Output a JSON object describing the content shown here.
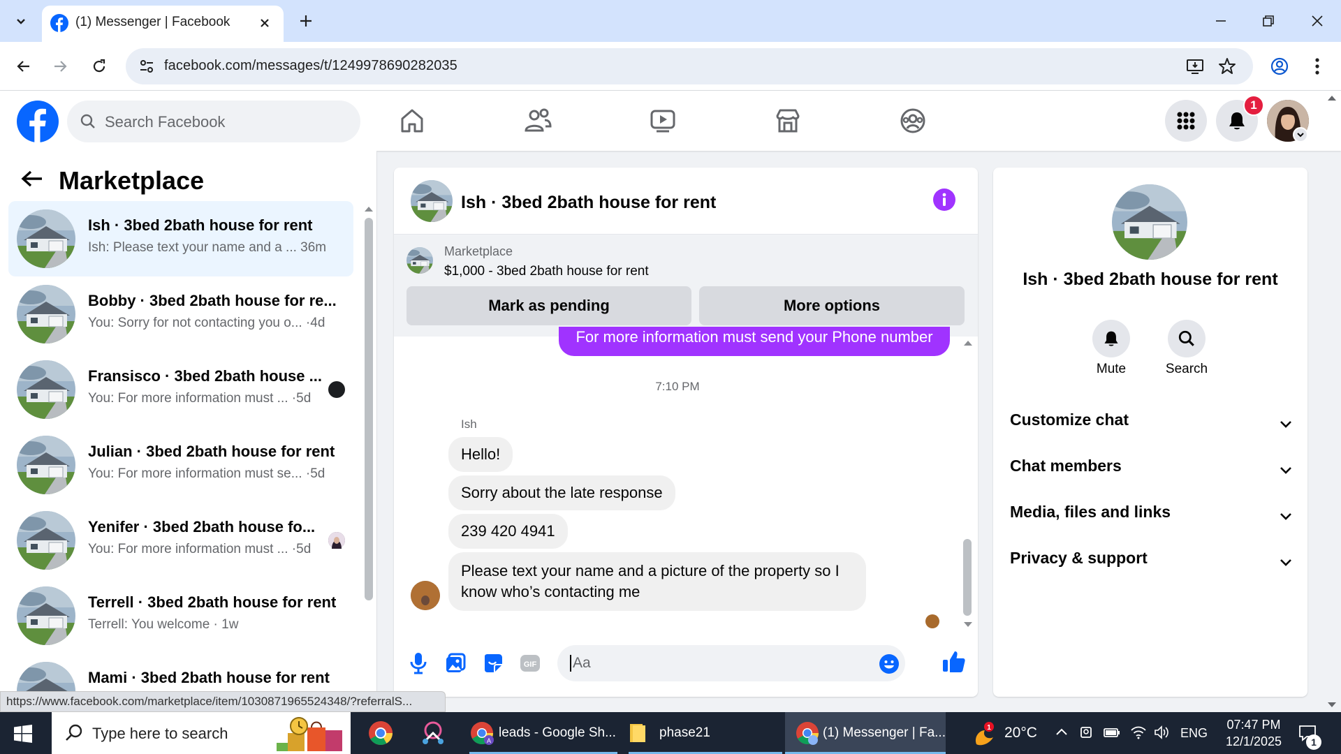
{
  "browser": {
    "tab_title": "(1) Messenger | Facebook",
    "url": "facebook.com/messages/t/1249978690282035",
    "status_url": "https://www.facebook.com/marketplace/item/1030871965524348/?referralS..."
  },
  "fb_nav": {
    "search_placeholder": "Search Facebook",
    "notification_count": "1"
  },
  "left_panel": {
    "heading": "Marketplace",
    "conversations": [
      {
        "name": "Ish · 3bed 2bath house for rent",
        "snippet": "Ish: Please text your name and a ... 36m"
      },
      {
        "name": "Bobby · 3bed 2bath house for re...",
        "snippet": "You: Sorry for not contacting you o... ·4d"
      },
      {
        "name": "Fransisco · 3bed 2bath house ...",
        "snippet": "You: For more information must ... ·5d"
      },
      {
        "name": "Julian · 3bed 2bath house for rent",
        "snippet": "You: For more information must se... ·5d"
      },
      {
        "name": "Yenifer · 3bed 2bath house fo...",
        "snippet": "You: For more information must ... ·5d"
      },
      {
        "name": "Terrell · 3bed 2bath house for rent",
        "snippet": "Terrell: You welcome · 1w"
      },
      {
        "name": "Mami · 3bed 2bath house for rent",
        "snippet": ""
      }
    ]
  },
  "chat": {
    "title": "Ish · 3bed 2bath house for rent",
    "marketplace_label": "Marketplace",
    "listing": "$1,000 - 3bed 2bath house for rent",
    "mark_pending": "Mark as pending",
    "more_options": "More options",
    "sent_message": "For more information must send your Phone number",
    "timestamp": "7:10 PM",
    "sender_name": "Ish",
    "messages": [
      "Hello!",
      "Sorry about the late response",
      "239 420 4941",
      "Please text your name and a picture of the property so I know who’s contacting me"
    ],
    "composer_placeholder": "Aa"
  },
  "info_panel": {
    "title": "Ish · 3bed 2bath house for rent",
    "mute_label": "Mute",
    "search_label": "Search",
    "sections": [
      "Customize chat",
      "Chat members",
      "Media, files and links",
      "Privacy & support"
    ]
  },
  "taskbar": {
    "search_placeholder": "Type here to search",
    "apps": [
      "leads - Google Sh...",
      "phase21",
      "(1) Messenger | Fa..."
    ],
    "temperature": "20°C",
    "language": "ENG",
    "time": "07:47 PM",
    "date": "12/1/2025",
    "notification_count": "1"
  },
  "colors": {
    "fb_blue": "#0866ff",
    "messenger_purple": "#a033ff",
    "notification_red": "#e41e3f"
  }
}
